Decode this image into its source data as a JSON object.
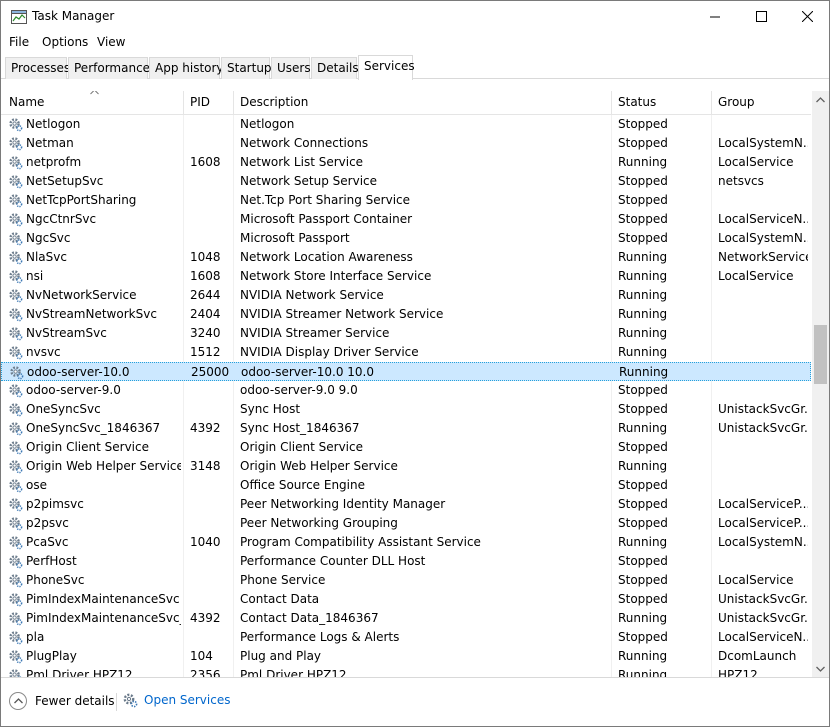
{
  "window": {
    "title": "Task Manager"
  },
  "menu": [
    "File",
    "Options",
    "View"
  ],
  "tabs": [
    "Processes",
    "Performance",
    "App history",
    "Startup",
    "Users",
    "Details",
    "Services"
  ],
  "active_tab": "Services",
  "columns": {
    "name": "Name",
    "pid": "PID",
    "description": "Description",
    "status": "Status",
    "group": "Group"
  },
  "rows": [
    {
      "name": "Netlogon",
      "pid": "",
      "description": "Netlogon",
      "status": "Stopped",
      "group": ""
    },
    {
      "name": "Netman",
      "pid": "",
      "description": "Network Connections",
      "status": "Stopped",
      "group": "LocalSystemN..."
    },
    {
      "name": "netprofm",
      "pid": "1608",
      "description": "Network List Service",
      "status": "Running",
      "group": "LocalService"
    },
    {
      "name": "NetSetupSvc",
      "pid": "",
      "description": "Network Setup Service",
      "status": "Stopped",
      "group": "netsvcs"
    },
    {
      "name": "NetTcpPortSharing",
      "pid": "",
      "description": "Net.Tcp Port Sharing Service",
      "status": "Stopped",
      "group": ""
    },
    {
      "name": "NgcCtnrSvc",
      "pid": "",
      "description": "Microsoft Passport Container",
      "status": "Stopped",
      "group": "LocalServiceN..."
    },
    {
      "name": "NgcSvc",
      "pid": "",
      "description": "Microsoft Passport",
      "status": "Stopped",
      "group": "LocalSystemN..."
    },
    {
      "name": "NlaSvc",
      "pid": "1048",
      "description": "Network Location Awareness",
      "status": "Running",
      "group": "NetworkService"
    },
    {
      "name": "nsi",
      "pid": "1608",
      "description": "Network Store Interface Service",
      "status": "Running",
      "group": "LocalService"
    },
    {
      "name": "NvNetworkService",
      "pid": "2644",
      "description": "NVIDIA Network Service",
      "status": "Running",
      "group": ""
    },
    {
      "name": "NvStreamNetworkSvc",
      "pid": "2404",
      "description": "NVIDIA Streamer Network Service",
      "status": "Running",
      "group": ""
    },
    {
      "name": "NvStreamSvc",
      "pid": "3240",
      "description": "NVIDIA Streamer Service",
      "status": "Running",
      "group": ""
    },
    {
      "name": "nvsvc",
      "pid": "1512",
      "description": "NVIDIA Display Driver Service",
      "status": "Running",
      "group": ""
    },
    {
      "name": "odoo-server-10.0",
      "pid": "25000",
      "description": "odoo-server-10.0 10.0",
      "status": "Running",
      "group": "",
      "selected": true
    },
    {
      "name": "odoo-server-9.0",
      "pid": "",
      "description": "odoo-server-9.0 9.0",
      "status": "Stopped",
      "group": ""
    },
    {
      "name": "OneSyncSvc",
      "pid": "",
      "description": "Sync Host",
      "status": "Stopped",
      "group": "UnistackSvcGr..."
    },
    {
      "name": "OneSyncSvc_1846367",
      "pid": "4392",
      "description": "Sync Host_1846367",
      "status": "Running",
      "group": "UnistackSvcGr..."
    },
    {
      "name": "Origin Client Service",
      "pid": "",
      "description": "Origin Client Service",
      "status": "Stopped",
      "group": ""
    },
    {
      "name": "Origin Web Helper Service",
      "pid": "3148",
      "description": "Origin Web Helper Service",
      "status": "Running",
      "group": ""
    },
    {
      "name": "ose",
      "pid": "",
      "description": "Office  Source Engine",
      "status": "Stopped",
      "group": ""
    },
    {
      "name": "p2pimsvc",
      "pid": "",
      "description": "Peer Networking Identity Manager",
      "status": "Stopped",
      "group": "LocalServiceP..."
    },
    {
      "name": "p2psvc",
      "pid": "",
      "description": "Peer Networking Grouping",
      "status": "Stopped",
      "group": "LocalServiceP..."
    },
    {
      "name": "PcaSvc",
      "pid": "1040",
      "description": "Program Compatibility Assistant Service",
      "status": "Running",
      "group": "LocalSystemN..."
    },
    {
      "name": "PerfHost",
      "pid": "",
      "description": "Performance Counter DLL Host",
      "status": "Stopped",
      "group": ""
    },
    {
      "name": "PhoneSvc",
      "pid": "",
      "description": "Phone Service",
      "status": "Stopped",
      "group": "LocalService"
    },
    {
      "name": "PimIndexMaintenanceSvc",
      "pid": "",
      "description": "Contact Data",
      "status": "Stopped",
      "group": "UnistackSvcGr..."
    },
    {
      "name": "PimIndexMaintenanceSvc_...",
      "pid": "4392",
      "description": "Contact Data_1846367",
      "status": "Running",
      "group": "UnistackSvcGr..."
    },
    {
      "name": "pla",
      "pid": "",
      "description": "Performance Logs & Alerts",
      "status": "Stopped",
      "group": "LocalServiceN..."
    },
    {
      "name": "PlugPlay",
      "pid": "104",
      "description": "Plug and Play",
      "status": "Running",
      "group": "DcomLaunch"
    },
    {
      "name": "Pml Driver HPZ12",
      "pid": "2356",
      "description": "Pml Driver HPZ12",
      "status": "Running",
      "group": "HPZ12"
    }
  ],
  "footer": {
    "fewer_details": "Fewer details",
    "open_services": "Open Services"
  },
  "colors": {
    "selection_bg": "#cce8ff",
    "link": "#0066cc",
    "gear": "#3c78b4"
  },
  "icons": {
    "app": "task-manager-icon",
    "row": "gear-icon",
    "fewer": "chevron-up-icon",
    "open_services": "services-icon"
  }
}
